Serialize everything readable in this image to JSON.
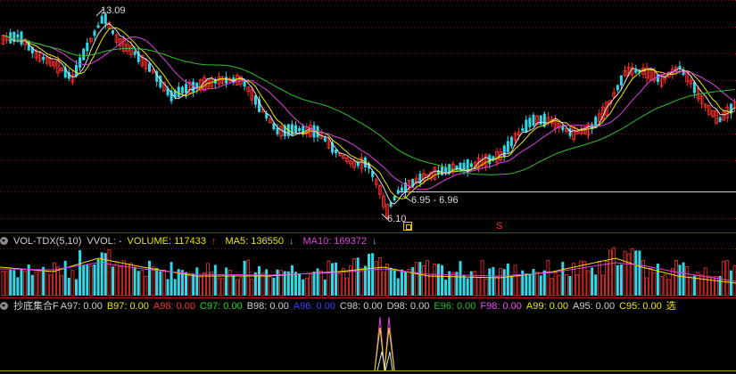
{
  "main_chart": {
    "high_label": "13.09",
    "low_label": "6.10",
    "range_label": "6.95 - 6.96",
    "marker_s": "S"
  },
  "vol_panel": {
    "title": "VOL-TDX(5,10)",
    "vvol": "VVOL: -",
    "volume": "VOLUME: 117433",
    "volume_arrow": "↑",
    "ma5": "MA5: 136550",
    "ma5_arrow": "↓",
    "ma10": "MA10: 169372",
    "ma10_arrow": "↓"
  },
  "indicator_panel": {
    "title": "抄底集合F",
    "items": [
      {
        "label": "A97: 0.00",
        "color": "#d0d0d0"
      },
      {
        "label": "B97: 0.00",
        "color": "#e8e800"
      },
      {
        "label": "A98: 0.00",
        "color": "#ff3030"
      },
      {
        "label": "C97: 0.00",
        "color": "#20e020"
      },
      {
        "label": "B98: 0.00",
        "color": "#d0d0d0"
      },
      {
        "label": "A96: 0.00",
        "color": "#4040ff"
      },
      {
        "label": "C98: 0.00",
        "color": "#d0d0d0"
      },
      {
        "label": "D98: 0.00",
        "color": "#d0d0d0"
      },
      {
        "label": "E96: 0.00",
        "color": "#20c020"
      },
      {
        "label": "F98: 0.00",
        "color": "#ff40ff"
      },
      {
        "label": "A99: 0.00",
        "color": "#e8e800"
      },
      {
        "label": "A95: 0.00",
        "color": "#d0d0d0"
      },
      {
        "label": "C95: 0.00",
        "color": "#e8e800"
      },
      {
        "label": "选",
        "color": "#e8e800"
      }
    ]
  },
  "colors": {
    "up": "#ff3030",
    "down": "#30d8e8",
    "ma_white": "#e0e0e0",
    "ma_yellow": "#e8e800",
    "ma_magenta": "#e040e0",
    "ma_green": "#30c030",
    "grid": "#8a1010"
  }
}
